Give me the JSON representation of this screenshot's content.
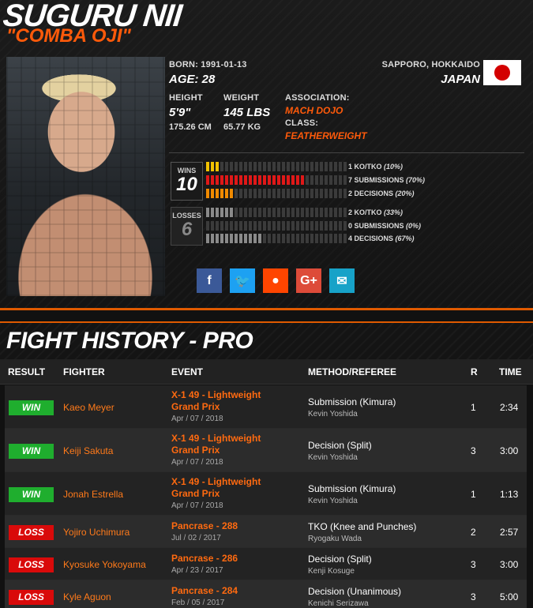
{
  "fighter": {
    "name": "SUGURU NII",
    "nickname": "\"COMBA OJI\"",
    "born": "BORN: 1991-01-13",
    "age": "AGE: 28",
    "location": "SAPPORO, HOKKAIDO",
    "country": "JAPAN",
    "height_label": "HEIGHT",
    "height_imperial": "5'9\"",
    "height_metric": "175.26 CM",
    "weight_label": "WEIGHT",
    "weight_imperial": "145 LBS",
    "weight_metric": "65.77 KG",
    "association_label": "ASSOCIATION:",
    "association": "MACH DOJO",
    "class_label": "CLASS:",
    "class": "FEATHERWEIGHT"
  },
  "record": {
    "wins_label": "WINS",
    "wins": "10",
    "losses_label": "LOSSES",
    "losses": "6",
    "win_breakdown": [
      {
        "count": 1,
        "label": "1 KO/TKO",
        "pct": "(10%)",
        "color": "#f2c200"
      },
      {
        "count": 7,
        "label": "7 SUBMISSIONS",
        "pct": "(70%)",
        "color": "#e01818"
      },
      {
        "count": 2,
        "label": "2 DECISIONS",
        "pct": "(20%)",
        "color": "#f08a00"
      }
    ],
    "loss_breakdown": [
      {
        "count": 2,
        "label": "2 KO/TKO",
        "pct": "(33%)",
        "color": "#8a8a8a"
      },
      {
        "count": 0,
        "label": "0 SUBMISSIONS",
        "pct": "(0%)",
        "color": "#8a8a8a"
      },
      {
        "count": 4,
        "label": "4 DECISIONS",
        "pct": "(67%)",
        "color": "#8a8a8a"
      }
    ]
  },
  "social": [
    {
      "icon": "facebook-icon",
      "glyph": "f",
      "color": "#3b5998"
    },
    {
      "icon": "twitter-icon",
      "glyph": "🐦",
      "color": "#1da1f2"
    },
    {
      "icon": "reddit-icon",
      "glyph": "●",
      "color": "#ff4500"
    },
    {
      "icon": "google-plus-icon",
      "glyph": "G+",
      "color": "#dd4b39"
    },
    {
      "icon": "email-icon",
      "glyph": "✉",
      "color": "#17a2c8"
    }
  ],
  "history": {
    "title": "FIGHT HISTORY - PRO",
    "columns": {
      "result": "RESULT",
      "fighter": "FIGHTER",
      "event": "EVENT",
      "method": "METHOD/REFEREE",
      "round": "R",
      "time": "TIME"
    },
    "fights": [
      {
        "result": "WIN",
        "type": "win",
        "fighter": "Kaeo Meyer",
        "event": "X-1 49 - Lightweight Grand Prix",
        "date": "Apr / 07 / 2018",
        "method": "Submission (Kimura)",
        "referee": "Kevin Yoshida",
        "round": "1",
        "time": "2:34"
      },
      {
        "result": "WIN",
        "type": "win",
        "fighter": "Keiji Sakuta",
        "event": "X-1 49 - Lightweight Grand Prix",
        "date": "Apr / 07 / 2018",
        "method": "Decision (Split)",
        "referee": "Kevin Yoshida",
        "round": "3",
        "time": "3:00"
      },
      {
        "result": "WIN",
        "type": "win",
        "fighter": "Jonah Estrella",
        "event": "X-1 49 - Lightweight Grand Prix",
        "date": "Apr / 07 / 2018",
        "method": "Submission (Kimura)",
        "referee": "Kevin Yoshida",
        "round": "1",
        "time": "1:13"
      },
      {
        "result": "LOSS",
        "type": "loss",
        "fighter": "Yojiro Uchimura",
        "event": "Pancrase - 288",
        "date": "Jul / 02 / 2017",
        "method": "TKO (Knee and Punches)",
        "referee": "Ryogaku Wada",
        "round": "2",
        "time": "2:57"
      },
      {
        "result": "LOSS",
        "type": "loss",
        "fighter": "Kyosuke Yokoyama",
        "event": "Pancrase - 286",
        "date": "Apr / 23 / 2017",
        "method": "Decision (Split)",
        "referee": "Kenji Kosuge",
        "round": "3",
        "time": "3:00"
      },
      {
        "result": "LOSS",
        "type": "loss",
        "fighter": "Kyle Aguon",
        "event": "Pancrase - 284",
        "date": "Feb / 05 / 2017",
        "method": "Decision (Unanimous)",
        "referee": "Kenichi Serizawa",
        "round": "3",
        "time": "5:00"
      }
    ]
  }
}
